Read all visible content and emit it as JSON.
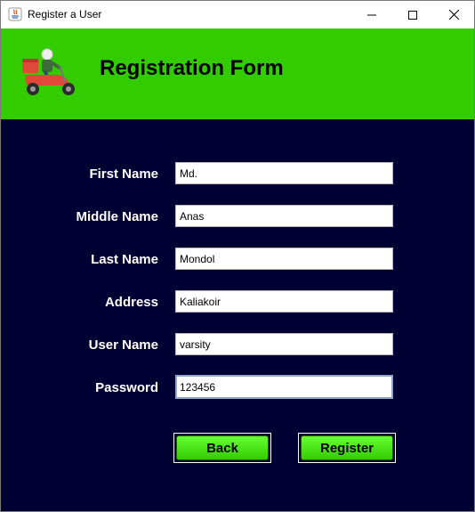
{
  "window": {
    "title": "Register a User",
    "controls": {
      "minimize": "minimize-icon",
      "maximize": "maximize-icon",
      "close": "close-icon"
    }
  },
  "header": {
    "title": "Registration Form",
    "logo": "delivery-scooter-icon",
    "background_color": "#33cc00"
  },
  "form": {
    "background_color": "#000033",
    "fields": [
      {
        "label": "First Name",
        "value": "Md."
      },
      {
        "label": "Middle Name",
        "value": "Anas"
      },
      {
        "label": "Last Name",
        "value": "Mondol"
      },
      {
        "label": "Address",
        "value": "Kaliakoir"
      },
      {
        "label": "User Name",
        "value": "varsity"
      },
      {
        "label": "Password",
        "value": "123456"
      }
    ],
    "focused_field": "Password"
  },
  "buttons": {
    "back_label": "Back",
    "register_label": "Register",
    "color": "#33cc00"
  }
}
